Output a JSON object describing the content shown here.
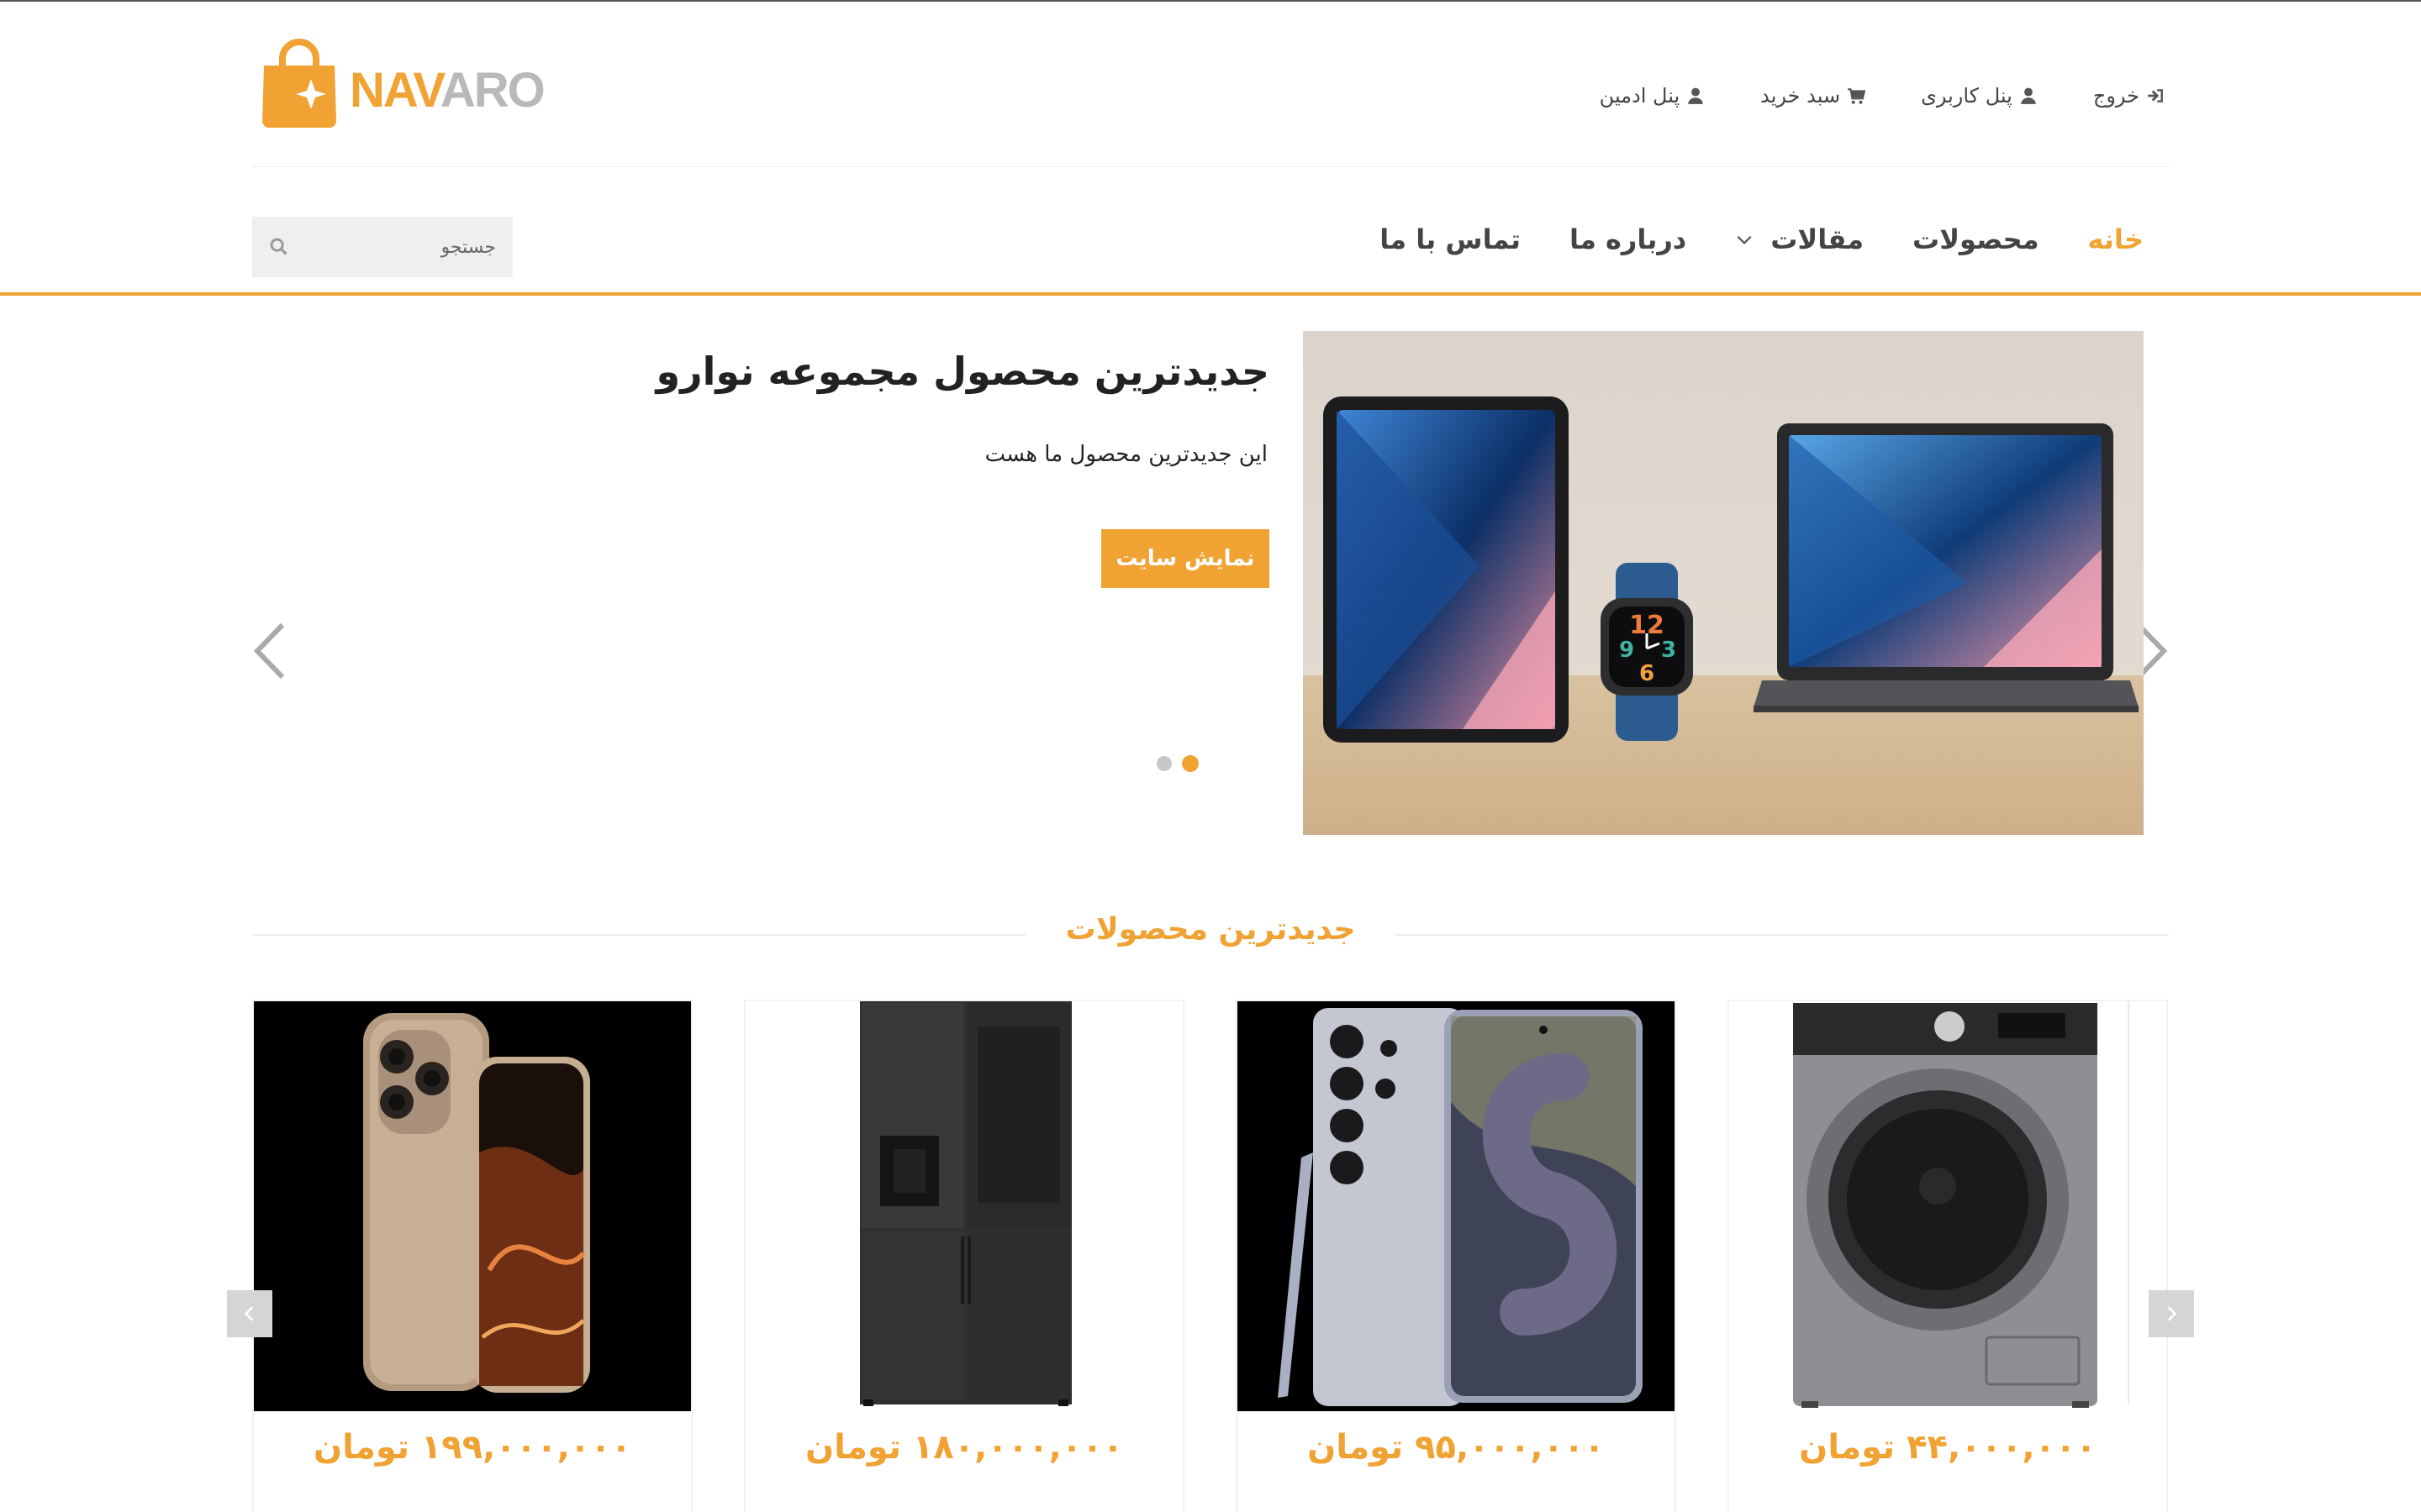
{
  "brand": {
    "logo_part1": "NAV",
    "logo_part2": "ARO",
    "accent_color": "#f0a233",
    "secondary_color": "#b9b9b9"
  },
  "user_links": [
    {
      "label": "پنل ادمین",
      "icon": "user-icon"
    },
    {
      "label": "سبد خرید",
      "icon": "cart-icon"
    },
    {
      "label": "پنل کاربری",
      "icon": "user-icon"
    },
    {
      "label": "خروج",
      "icon": "sign-out-icon"
    }
  ],
  "nav": {
    "items": [
      {
        "label": "خانه",
        "active": true
      },
      {
        "label": "محصولات",
        "active": false
      },
      {
        "label": "مقالات",
        "active": false,
        "dropdown": true
      },
      {
        "label": "درباره ما",
        "active": false
      },
      {
        "label": "تماس با ما",
        "active": false
      }
    ]
  },
  "search": {
    "placeholder": "جستجو",
    "value": ""
  },
  "hero": {
    "title": "جدیدترین محصول مجموعه نوارو",
    "subtitle": "این جدیدترین محصول ما هست",
    "button_label": "نمایش سایت",
    "slide_count": 2,
    "active_slide": 1,
    "image": "ipad-watch-macbook"
  },
  "latest_products": {
    "title": "جدیدترین محصولات",
    "items": [
      {
        "image": "washing-machine",
        "price": "۴۴,۰۰۰,۰۰۰ تومان"
      },
      {
        "image": "galaxy-phone",
        "price": "۹۵,۰۰۰,۰۰۰ تومان"
      },
      {
        "image": "refrigerator",
        "price": "۱۸۰,۰۰۰,۰۰۰ تومان"
      },
      {
        "image": "iphone",
        "price": "۱۹۹,۰۰۰,۰۰۰ تومان"
      }
    ]
  }
}
